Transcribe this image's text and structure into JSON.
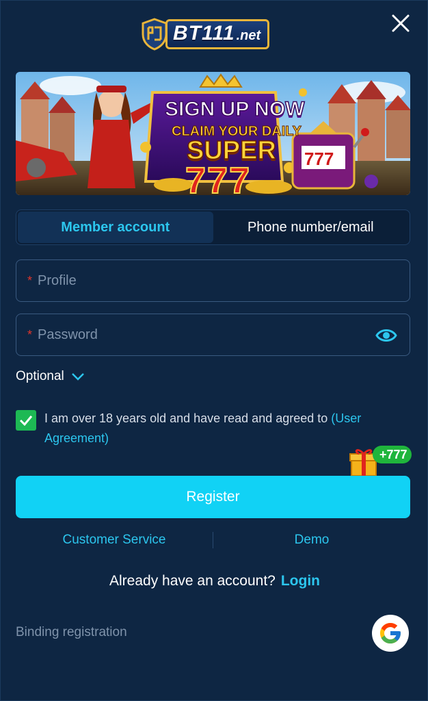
{
  "logo": {
    "main": "BT111",
    "tld": ".net"
  },
  "banner": {
    "line1": "SIGN UP NOW",
    "line2": "CLAIM YOUR DAILY",
    "line3": "SUPER",
    "line4": "777"
  },
  "tabs": [
    {
      "label": "Member account",
      "active": true
    },
    {
      "label": "Phone number/email",
      "active": false
    }
  ],
  "form": {
    "profile": {
      "required_mark": "*",
      "placeholder": "Profile",
      "value": ""
    },
    "password": {
      "required_mark": "*",
      "placeholder": "Password",
      "value": ""
    },
    "optional_label": "Optional"
  },
  "agreement": {
    "checked": true,
    "text": "I am over 18 years old and have read and agreed to ",
    "link": "(User Agreement)"
  },
  "gift_badge": {
    "label": "+777"
  },
  "register_button": "Register",
  "footer_links": {
    "customer_service": "Customer Service",
    "demo": "Demo"
  },
  "login_prompt": {
    "text": "Already have an account?",
    "link": "Login"
  },
  "binding_label": "Binding registration",
  "colors": {
    "background": "#0e2643",
    "accent": "#2cc6ee",
    "button": "#11d2f5",
    "checkbox": "#1db954",
    "required": "#e0352a"
  }
}
